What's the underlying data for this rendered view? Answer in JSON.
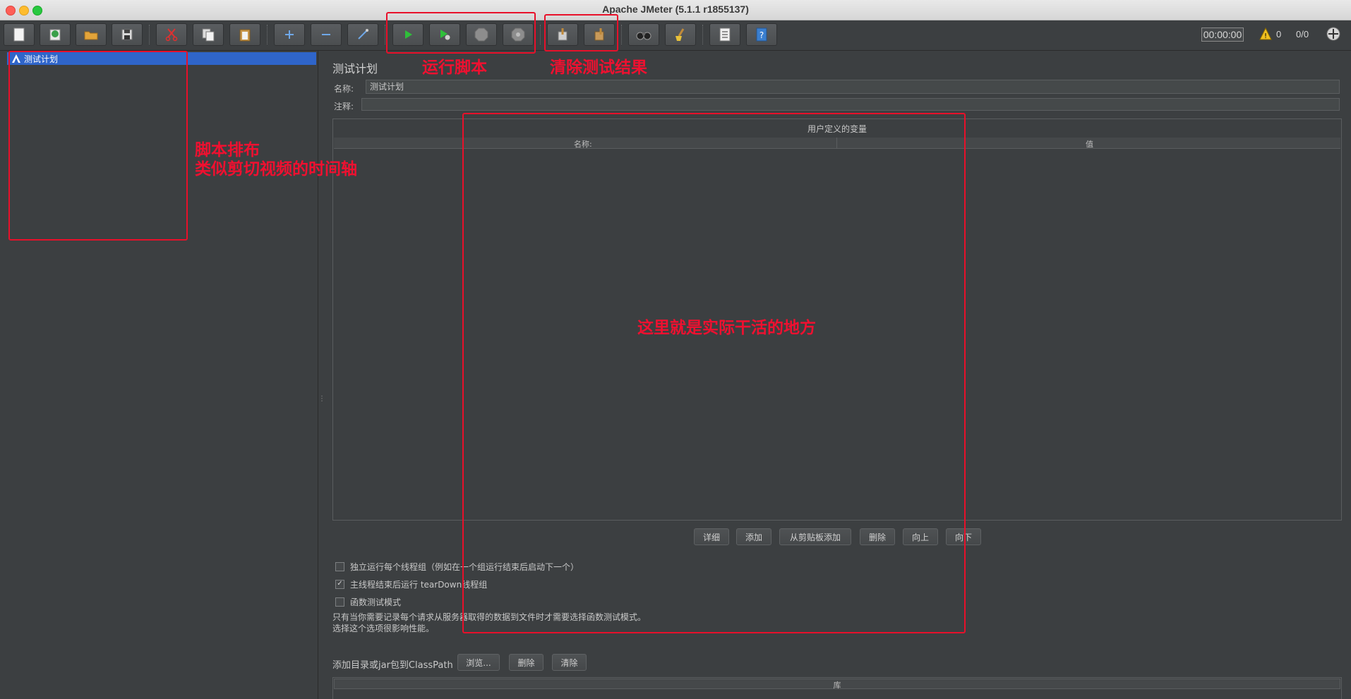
{
  "window": {
    "title": "Apache JMeter (5.1.1 r1855137)"
  },
  "toolbar": {
    "buttons": [
      {
        "id": "new",
        "icon": "new-document-icon"
      },
      {
        "id": "templates",
        "icon": "templates-icon"
      },
      {
        "id": "open",
        "icon": "open-folder-icon"
      },
      {
        "id": "save",
        "icon": "save-disk-icon"
      },
      {
        "id": "cut",
        "icon": "scissors-icon"
      },
      {
        "id": "copy",
        "icon": "copy-icon"
      },
      {
        "id": "paste",
        "icon": "clipboard-icon"
      },
      {
        "id": "expand",
        "icon": "plus-icon"
      },
      {
        "id": "collapse",
        "icon": "minus-icon"
      },
      {
        "id": "toggle",
        "icon": "toggle-wand-icon"
      },
      {
        "id": "start",
        "icon": "play-icon"
      },
      {
        "id": "start-no-pause",
        "icon": "play-no-timers-icon"
      },
      {
        "id": "stop",
        "icon": "stop-icon"
      },
      {
        "id": "shutdown",
        "icon": "shutdown-icon"
      },
      {
        "id": "clear",
        "icon": "clear-broom-icon"
      },
      {
        "id": "clear-all",
        "icon": "clear-all-broom-icon"
      },
      {
        "id": "search",
        "icon": "binoculars-icon"
      },
      {
        "id": "reset-search",
        "icon": "reset-search-broom-icon"
      },
      {
        "id": "function-helper",
        "icon": "function-list-icon"
      },
      {
        "id": "help",
        "icon": "help-book-icon"
      }
    ],
    "timer": "00:00:00",
    "warnings": "0",
    "threads": "0/0"
  },
  "tree": {
    "root_label": "测试计划"
  },
  "panel": {
    "title": "测试计划",
    "name_label": "名称:",
    "name_value": "测试计划",
    "comment_label": "注释:",
    "comment_value": "",
    "vars_title": "用户定义的变量",
    "col_name": "名称:",
    "col_value": "值",
    "buttons": {
      "detail": "详细",
      "add": "添加",
      "add_clipboard": "从剪贴板添加",
      "delete": "删除",
      "up": "向上",
      "down": "向下"
    },
    "checkbox_serial": "独立运行每个线程组（例如在一个组运行结束后启动下一个）",
    "checkbox_teardown": "主线程结束后运行 tearDown线程组",
    "checkbox_functional": "函数测试模式",
    "teardown_checked": true,
    "note_line1": "只有当你需要记录每个请求从服务器取得的数据到文件时才需要选择函数测试模式。",
    "note_line2": "选择这个选项很影响性能。",
    "classpath_label": "添加目录或jar包到ClassPath",
    "browse": "浏览...",
    "cp_delete": "删除",
    "cp_clear": "清除",
    "lib_header": "库"
  },
  "annotations": {
    "run_script": "运行脚本",
    "clear_results": "清除测试结果",
    "script_layout_line1": "脚本排布",
    "script_layout_line2": "类似剪切视频的时间轴",
    "work_area": "这里就是实际干活的地方",
    "color": "#e8102a"
  }
}
